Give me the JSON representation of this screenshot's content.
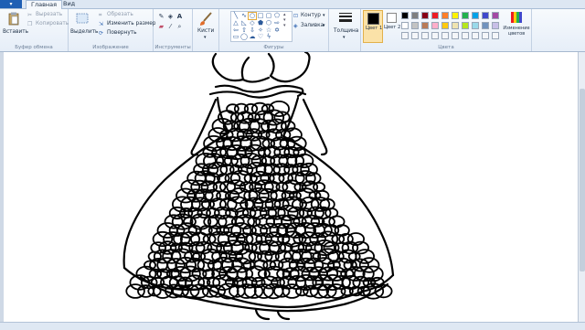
{
  "tabs": {
    "app_menu": "▾",
    "home": "Главная",
    "view": "Вид"
  },
  "clipboard": {
    "paste": "Вставить",
    "cut": "Вырезать",
    "copy": "Копировать",
    "group": "Буфер обмена"
  },
  "image": {
    "select": "Выделить",
    "crop": "Обрезать",
    "resize": "Изменить размер",
    "rotate": "Повернуть",
    "group": "Изображение"
  },
  "tools": {
    "group": "Инструменты",
    "text_tool": "A"
  },
  "brushes": {
    "label": "Кисти"
  },
  "shapes": {
    "outline": "Контур",
    "fill": "Заливка",
    "group": "Фигуры"
  },
  "size": {
    "label": "Толщина"
  },
  "colors": {
    "color1": "Цвет 1",
    "color2": "Цвет 2",
    "edit": "Изменение цветов",
    "group": "Цвета",
    "color1_value": "#000000",
    "color2_value": "#ffffff",
    "palette_row1": [
      "#000000",
      "#7f7f7f",
      "#880015",
      "#ed1c24",
      "#ff7f27",
      "#fff200",
      "#22b14c",
      "#00a2e8",
      "#3f48cc",
      "#a349a4"
    ],
    "palette_row2": [
      "#ffffff",
      "#c3c3c3",
      "#b97a57",
      "#ffaec9",
      "#ffc90e",
      "#efe4b0",
      "#b5e61d",
      "#99d9ea",
      "#7092be",
      "#c8bfe7"
    ]
  }
}
